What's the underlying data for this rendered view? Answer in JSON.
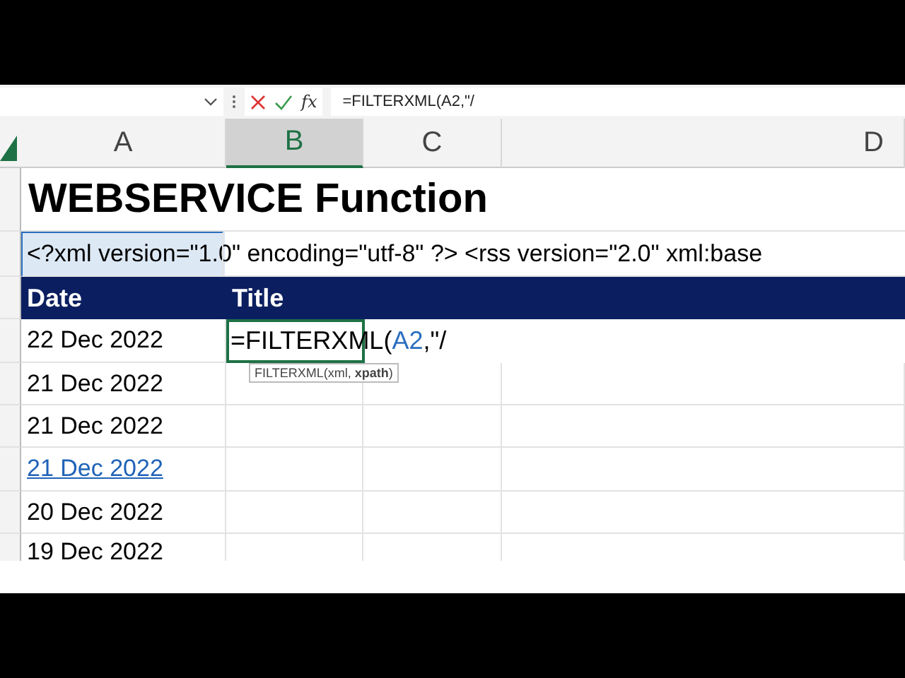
{
  "formula_bar": {
    "function_label": "fx",
    "formula": "=FILTERXML(A2,\"/"
  },
  "columns": [
    {
      "label": "A",
      "selected": false
    },
    {
      "label": "B",
      "selected": true
    },
    {
      "label": "C",
      "selected": false
    },
    {
      "label": "D",
      "selected": false
    }
  ],
  "title": "WEBSERVICE Function",
  "xml_cell": {
    "text": "<?xml version=\"1.0\" encoding=\"utf-8\" ?> <rss version=\"2.0\" xml:base",
    "referenced": true
  },
  "header": [
    "Date",
    "Title"
  ],
  "editing_cell": {
    "parts": [
      {
        "text": "=FILTERXML(",
        "kind": "plain"
      },
      {
        "text": "A2",
        "kind": "ref"
      },
      {
        "text": ",\"/",
        "kind": "plain"
      }
    ],
    "tooltip": "FILTERXML(xml, **xpath**)"
  },
  "rows": [
    {
      "date": "22 Dec 2022",
      "kind": "plain"
    },
    {
      "date": "21 Dec 2022",
      "kind": "plain"
    },
    {
      "date": "21 Dec 2022",
      "kind": "plain"
    },
    {
      "date": "21 Dec 2022",
      "kind": "link"
    },
    {
      "date": "20 Dec 2022",
      "kind": "plain"
    },
    {
      "date": "19 Dec 2022",
      "kind": "plain"
    }
  ]
}
